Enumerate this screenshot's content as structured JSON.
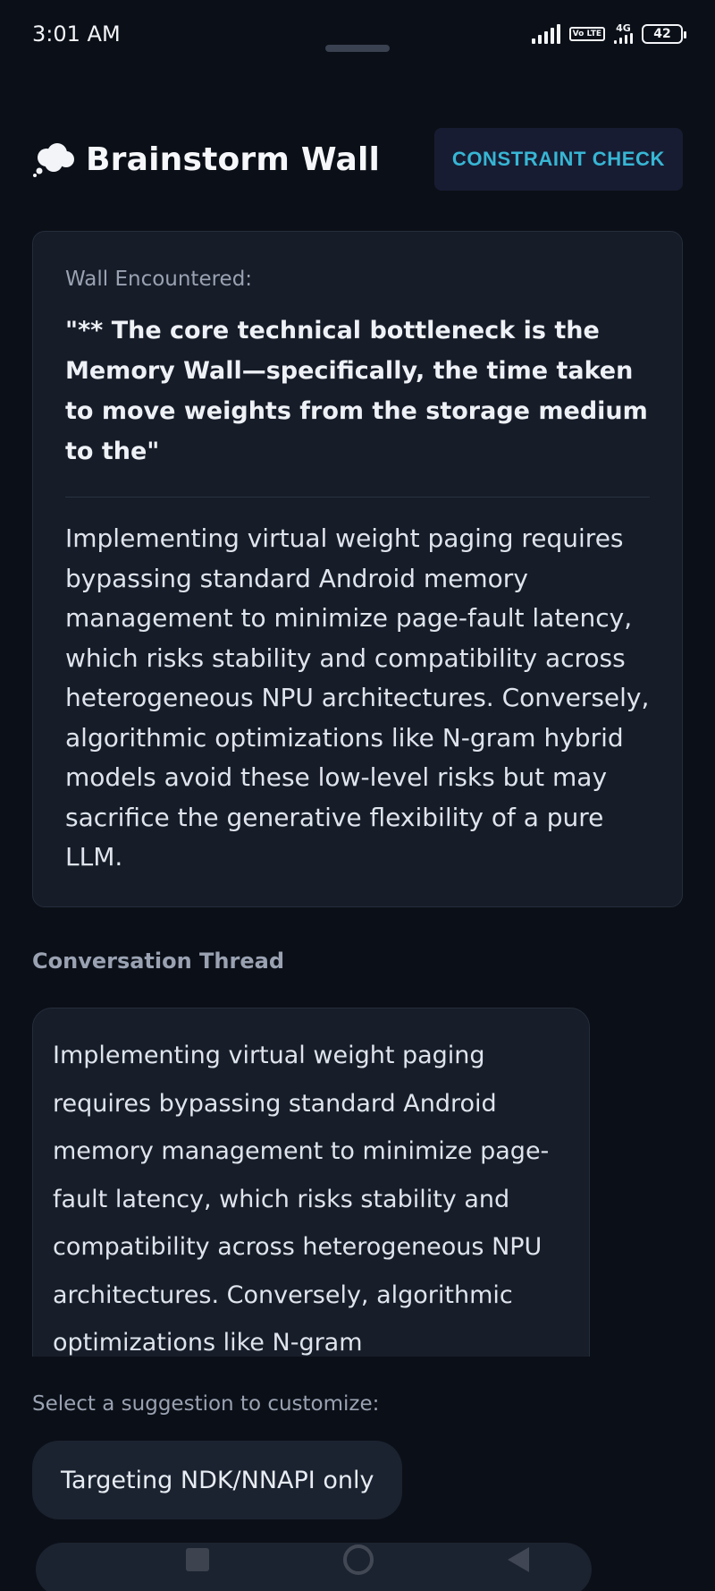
{
  "status_bar": {
    "time": "3:01 AM",
    "volte_label": "Vo LTE",
    "network_label": "4G",
    "battery_level": "42"
  },
  "header": {
    "icon": "thought-cloud-icon",
    "title": "Brainstorm Wall",
    "constraint_check_label": "CONSTRAINT CHECK"
  },
  "wall": {
    "label": "Wall Encountered:",
    "quote": "\"** The core technical bottleneck is the Memory Wall—specifically, the time taken to move weights from the storage medium to the\"",
    "body": "Implementing virtual weight paging requires bypassing standard Android memory management to minimize page-fault latency, which risks stability and compatibility across heterogeneous NPU architectures. Conversely, algorithmic optimizations like N-gram hybrid models avoid these low-level risks but may sacrifice the generative flexibility of a pure LLM."
  },
  "conversation": {
    "heading": "Conversation Thread",
    "messages": [
      {
        "text": "Implementing virtual weight paging requires bypassing standard Android memory management to minimize page-fault latency, which risks stability and compatibility across heterogeneous NPU architectures. Conversely, algorithmic optimizations like N-gram"
      }
    ]
  },
  "suggestions": {
    "label": "Select a suggestion to customize:",
    "items": [
      {
        "label": "Targeting NDK/NNAPI only"
      }
    ]
  },
  "colors": {
    "background": "#0b0f17",
    "card": "#161c28",
    "accent": "#37b6d4",
    "button_bg": "#181c33"
  }
}
